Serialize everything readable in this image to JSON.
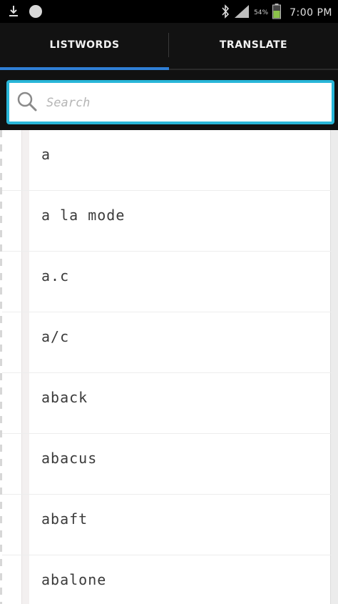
{
  "status_bar": {
    "time": "7:00 PM",
    "battery_percent": "54%",
    "icons": [
      "download-icon",
      "notification-dot-icon",
      "bluetooth-icon",
      "signal-icon",
      "battery-icon"
    ]
  },
  "tabs": [
    {
      "label": "LISTWORDS",
      "active": true
    },
    {
      "label": "TRANSLATE",
      "active": false
    }
  ],
  "search": {
    "placeholder": "Search",
    "value": ""
  },
  "words": [
    "a",
    "a la mode",
    "a.c",
    "a/c",
    "aback",
    "abacus",
    "abaft",
    "abalone"
  ],
  "colors": {
    "accent": "#2f7fd6",
    "search_border": "#29b6d8",
    "tab_bar": "#121212"
  }
}
